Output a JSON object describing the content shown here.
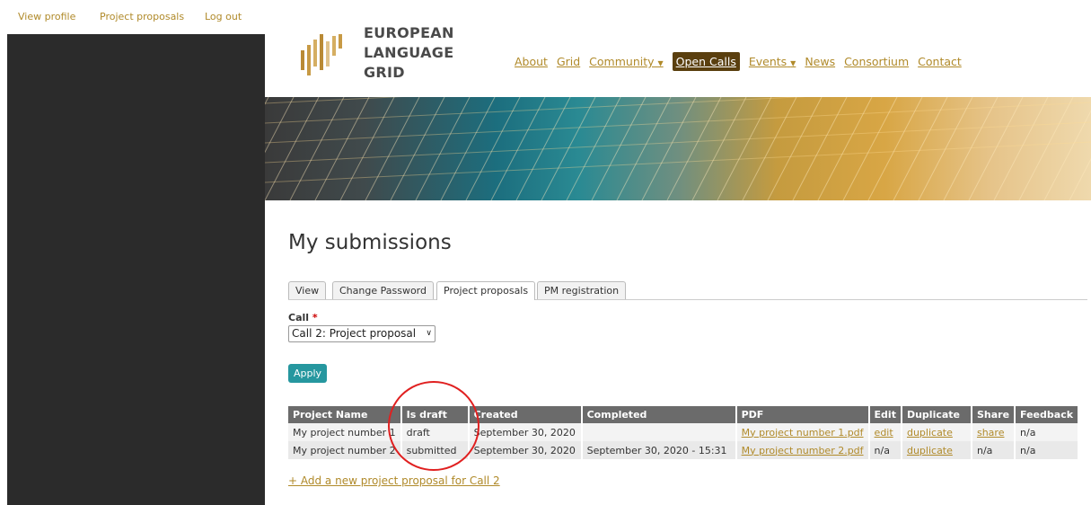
{
  "topbar": {
    "view_profile": "View profile",
    "project_proposals": "Project proposals",
    "log_out": "Log out"
  },
  "logo": {
    "line1": "EUROPEAN",
    "line2": "LANGUAGE",
    "line3": "GRID"
  },
  "nav": {
    "items": [
      {
        "label": "About"
      },
      {
        "label": "Grid"
      },
      {
        "label": "Community"
      },
      {
        "label": "Open Calls"
      },
      {
        "label": "Events"
      },
      {
        "label": "News"
      },
      {
        "label": "Consortium"
      },
      {
        "label": "Contact"
      }
    ],
    "dropdown_marker": "▼"
  },
  "page": {
    "title": "My submissions"
  },
  "tabs": [
    {
      "label": "View"
    },
    {
      "label": "Change Password"
    },
    {
      "label": "Project proposals"
    },
    {
      "label": "PM registration"
    }
  ],
  "form": {
    "call_label": "Call",
    "required_marker": "*",
    "call_selected": "Call 2: Project proposal",
    "apply_label": "Apply"
  },
  "table": {
    "headers": [
      "Project Name",
      "Is draft",
      "Created",
      "Completed",
      "PDF",
      "Edit",
      "Duplicate",
      "Share",
      "Feedback"
    ],
    "rows": [
      {
        "name": "My project number 1",
        "is_draft": "draft",
        "created": "September 30, 2020",
        "completed": "",
        "pdf": "My project number 1.pdf",
        "edit": "edit",
        "duplicate": "duplicate",
        "share": "share",
        "feedback": "n/a"
      },
      {
        "name": "My project number 2",
        "is_draft": "submitted",
        "created": "September 30, 2020",
        "completed": "September 30, 2020 - 15:31",
        "pdf": "My project number 2.pdf",
        "edit": "n/a",
        "duplicate": "duplicate",
        "share": "n/a",
        "feedback": "n/a"
      }
    ]
  },
  "add_link": "+ Add a new project proposal for Call 2",
  "colors": {
    "link": "#b08a2a",
    "active_nav_bg": "#5a3f0f",
    "apply_button": "#26979f",
    "table_header": "#6b6b6b",
    "annotation_circle": "#e02020"
  }
}
